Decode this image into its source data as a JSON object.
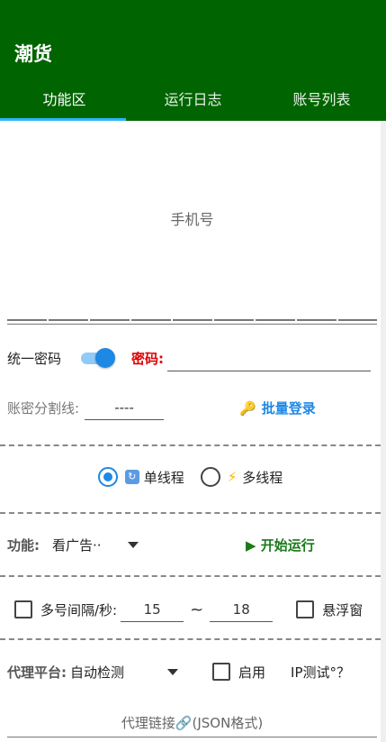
{
  "app": {
    "title": "潮货"
  },
  "tabs": [
    {
      "label": "功能区",
      "active": true
    },
    {
      "label": "运行日志",
      "active": false
    },
    {
      "label": "账号列表",
      "active": false
    }
  ],
  "phone": {
    "placeholder": "手机号",
    "value": ""
  },
  "password_row": {
    "unified_label": "统一密码",
    "switch_on": true,
    "password_label": "密码:",
    "password_value": ""
  },
  "split_row": {
    "label": "账密分割线:",
    "value": "----",
    "batch_login": "批量登录",
    "batch_icon": "key-icon"
  },
  "thread_row": {
    "single": "单线程",
    "multi": "多线程",
    "selected": "single"
  },
  "function_row": {
    "label": "功能:",
    "selected": "看广告··",
    "start": "▶ 开始运行"
  },
  "interval_row": {
    "label": "多号间隔/秒:",
    "min": "15",
    "tilde": "~",
    "max": "18",
    "float_window": "悬浮窗"
  },
  "proxy_row": {
    "label": "代理平台:",
    "selected": "自动检测",
    "enable": "启用",
    "ip_test": "IP测试°？"
  },
  "proxy_link": {
    "placeholder": "代理链接🔗(JSON格式)"
  },
  "colors": {
    "appbar": "#006400",
    "accent": "#1e88e5",
    "tab_indicator": "#29b6f6",
    "password_label": "#e00000",
    "start": "#1b7a1b"
  }
}
